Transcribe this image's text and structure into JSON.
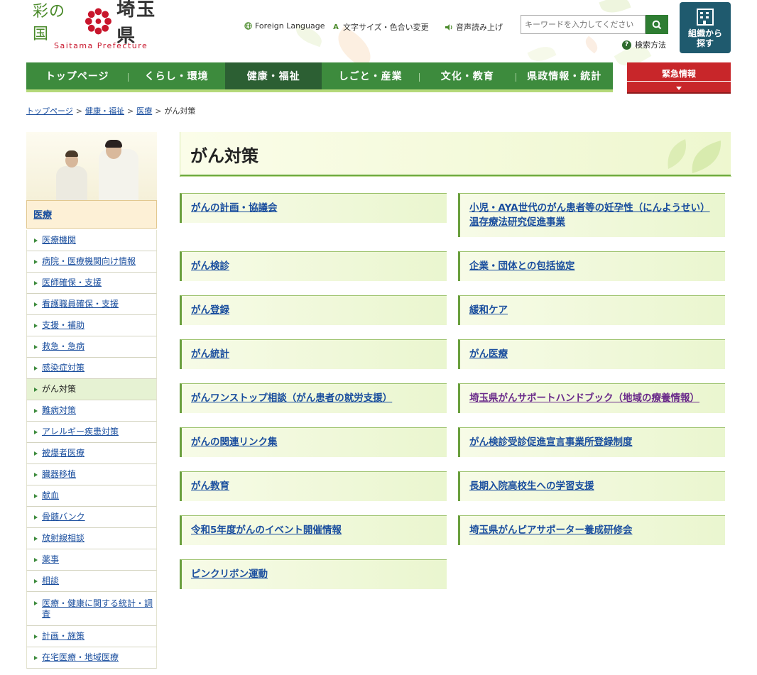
{
  "header": {
    "logo": {
      "main_text": "彩の国",
      "pref_name": "埼玉県",
      "english": "Saitama Prefecture"
    },
    "utility": {
      "foreign_language": "Foreign Language",
      "text_size_color": "文字サイズ・色合い変更",
      "read_aloud": "音声読み上げ"
    },
    "search": {
      "placeholder": "キーワードを入力してください",
      "help_label": "検索方法"
    },
    "org_button": {
      "line1": "組織から",
      "line2": "探す"
    }
  },
  "nav": {
    "items": [
      {
        "label": "トップページ"
      },
      {
        "label": "くらし・環境"
      },
      {
        "label": "健康・福祉"
      },
      {
        "label": "しごと・産業"
      },
      {
        "label": "文化・教育"
      },
      {
        "label": "県政情報・統計"
      }
    ],
    "emergency_label": "緊急情報"
  },
  "breadcrumb": {
    "items": [
      {
        "label": "トップページ"
      },
      {
        "label": "健康・福祉"
      },
      {
        "label": "医療"
      }
    ],
    "current": "がん対策",
    "separator": ">"
  },
  "sidebar": {
    "heading": "医療",
    "items": [
      {
        "label": "医療機関"
      },
      {
        "label": "病院・医療機関向け情報"
      },
      {
        "label": "医師確保・支援"
      },
      {
        "label": "看護職員確保・支援"
      },
      {
        "label": "支援・補助"
      },
      {
        "label": "救急・急病"
      },
      {
        "label": "感染症対策"
      },
      {
        "label": "がん対策"
      },
      {
        "label": "難病対策"
      },
      {
        "label": "アレルギー疾患対策"
      },
      {
        "label": "被爆者医療"
      },
      {
        "label": "臓器移植"
      },
      {
        "label": "献血"
      },
      {
        "label": "骨髄バンク"
      },
      {
        "label": "放射線相談"
      },
      {
        "label": "薬事"
      },
      {
        "label": "相談"
      },
      {
        "label": "医療・健康に関する統計・調査"
      },
      {
        "label": "計画・施策"
      },
      {
        "label": "在宅医療・地域医療"
      }
    ]
  },
  "main": {
    "title": "がん対策",
    "left_links": [
      {
        "label": "がんの計画・協議会"
      },
      {
        "label": "がん検診"
      },
      {
        "label": "がん登録"
      },
      {
        "label": "がん統計"
      },
      {
        "label": "がんワンストップ相談（がん患者の就労支援）"
      },
      {
        "label": "がんの関連リンク集"
      },
      {
        "label": "がん教育"
      },
      {
        "label": "令和5年度がんのイベント開催情報"
      },
      {
        "label": "ピンクリボン運動"
      }
    ],
    "right_links": [
      {
        "label": "小児・AYA世代のがん患者等の妊孕性（にんようせい）温存療法研究促進事業"
      },
      {
        "label": "企業・団体との包括協定"
      },
      {
        "label": "緩和ケア"
      },
      {
        "label": "がん医療"
      },
      {
        "label": "埼玉県がんサポートハンドブック（地域の療養情報）"
      },
      {
        "label": "がん検診受診促進宣言事業所登録制度"
      },
      {
        "label": "長期入院高校生への学習支援"
      },
      {
        "label": "埼玉県がんピアサポーター養成研修会"
      }
    ]
  },
  "colors": {
    "nav_green": "#3d8b3d",
    "nav_active": "#2c5f33",
    "emergency_red": "#c8262a",
    "org_button": "#1f5a6e",
    "link_blue": "#1a4e9e"
  }
}
